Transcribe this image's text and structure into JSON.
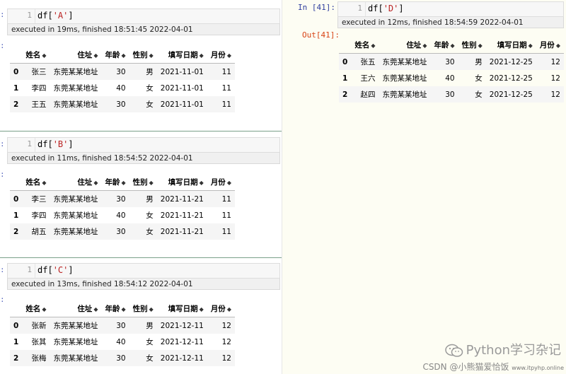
{
  "cells": [
    {
      "prompt": ":",
      "line_number": "1",
      "code_prefix": "df[",
      "code_string": "'A'",
      "code_suffix": "]",
      "exec_text": "executed in 19ms, finished 18:51:45 2022-04-01",
      "out_prompt": ":",
      "headers": [
        "",
        "姓名",
        "住址",
        "年龄",
        "性别",
        "填写日期",
        "月份"
      ],
      "rows": [
        [
          "0",
          "张三",
          "东莞某某地址",
          "30",
          "男",
          "2021-11-01",
          "11"
        ],
        [
          "1",
          "李四",
          "东莞某某地址",
          "40",
          "女",
          "2021-11-01",
          "11"
        ],
        [
          "2",
          "王五",
          "东莞某某地址",
          "30",
          "女",
          "2021-11-01",
          "11"
        ]
      ]
    },
    {
      "prompt": ":",
      "line_number": "1",
      "code_prefix": "df[",
      "code_string": "'B'",
      "code_suffix": "]",
      "exec_text": "executed in 11ms, finished 18:54:52 2022-04-01",
      "out_prompt": ":",
      "headers": [
        "",
        "姓名",
        "住址",
        "年龄",
        "性别",
        "填写日期",
        "月份"
      ],
      "rows": [
        [
          "0",
          "李三",
          "东莞某某地址",
          "30",
          "男",
          "2021-11-21",
          "11"
        ],
        [
          "1",
          "李四",
          "东莞某某地址",
          "40",
          "女",
          "2021-11-21",
          "11"
        ],
        [
          "2",
          "胡五",
          "东莞某某地址",
          "30",
          "女",
          "2021-11-21",
          "11"
        ]
      ]
    },
    {
      "prompt": ":",
      "line_number": "1",
      "code_prefix": "df[",
      "code_string": "'C'",
      "code_suffix": "]",
      "exec_text": "executed in 13ms, finished 18:54:12 2022-04-01",
      "out_prompt": ":",
      "headers": [
        "",
        "姓名",
        "住址",
        "年龄",
        "性别",
        "填写日期",
        "月份"
      ],
      "rows": [
        [
          "0",
          "张新",
          "东莞某某地址",
          "30",
          "男",
          "2021-12-11",
          "12"
        ],
        [
          "1",
          "张其",
          "东莞某某地址",
          "40",
          "女",
          "2021-12-11",
          "12"
        ],
        [
          "2",
          "张梅",
          "东莞某某地址",
          "30",
          "女",
          "2021-12-11",
          "12"
        ]
      ]
    },
    {
      "prompt": "In  [41]:",
      "line_number": "1",
      "code_prefix": "df[",
      "code_string": "'D'",
      "code_suffix": "]",
      "exec_text": "executed in 12ms, finished 18:54:59 2022-04-01",
      "out_prompt": "Out[41]:",
      "headers": [
        "",
        "姓名",
        "住址",
        "年龄",
        "性别",
        "填写日期",
        "月份"
      ],
      "rows": [
        [
          "0",
          "张五",
          "东莞某某地址",
          "30",
          "男",
          "2021-12-25",
          "12"
        ],
        [
          "1",
          "王六",
          "东莞某某地址",
          "40",
          "女",
          "2021-12-25",
          "12"
        ],
        [
          "2",
          "赵四",
          "东莞某某地址",
          "30",
          "女",
          "2021-12-25",
          "12"
        ]
      ]
    }
  ],
  "sort_glyph": "◆",
  "watermark": {
    "main": "Python学习杂记",
    "footer": "CSDN @小熊猫爱恰饭",
    "footer_small": "www.itpyhp.online"
  },
  "colors": {
    "right_pane_bg": "#fdfdf3",
    "in_prompt": "#303f9f",
    "out_prompt": "#d84315",
    "string": "#ba2121"
  }
}
